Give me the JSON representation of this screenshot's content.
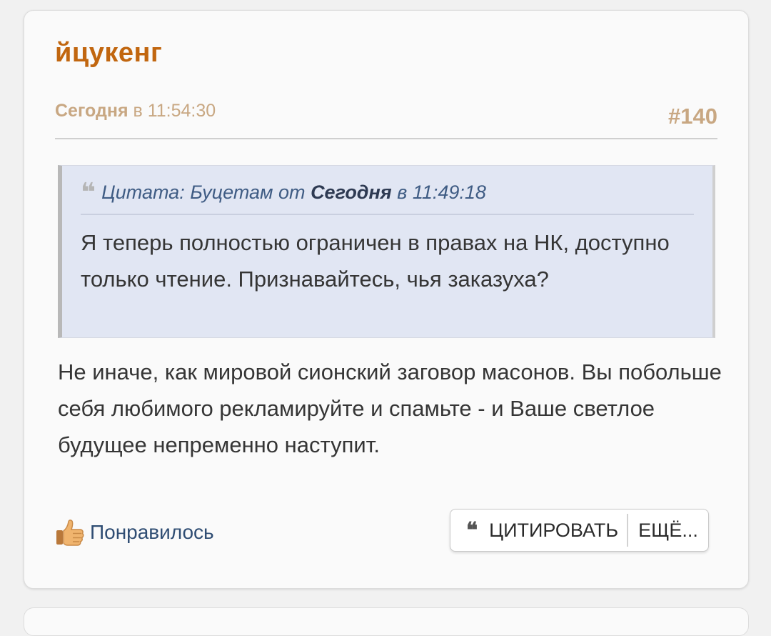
{
  "post": {
    "author": "йцукенг",
    "date_day": "Сегодня",
    "date_rest": " в 11:54:30",
    "number": "#140",
    "quote": {
      "prefix": "Цитата: Буцетам от ",
      "day": "Сегодня",
      "suffix": " в 11:49:18",
      "text": "Я теперь полностью ограничен в правах на НК, доступно только чтение. Признавайтесь, чья заказуха?"
    },
    "body": "Не иначе, как мировой сионский заговор масонов. Вы побольше себя любимого рекламируйте и спамьте - и Ваше светлое будущее непременно наступит."
  },
  "actions": {
    "like_label": "Понравилось",
    "quote_icon_glyph": "❝",
    "quote_button": "ЦИТИРОВАТЬ",
    "more_button": "ЕЩЁ..."
  },
  "icons": {
    "quote_mark": "quote-mark-icon",
    "like": "thumbs-up-icon"
  },
  "colors": {
    "author": "#c1660f",
    "meta": "#c8a782",
    "quote_bg": "#e1e6f3",
    "link": "#2f4d73"
  }
}
